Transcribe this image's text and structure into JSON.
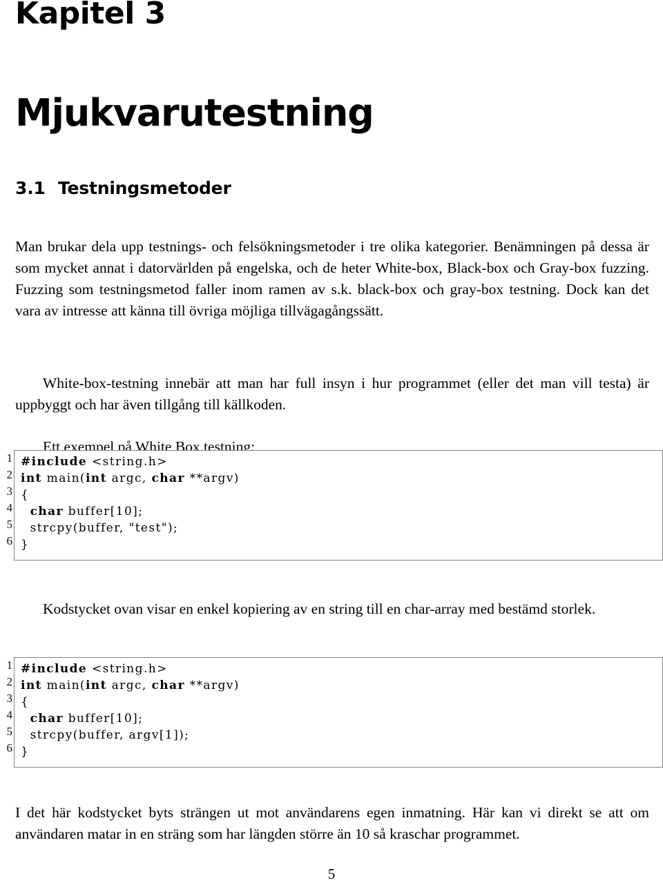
{
  "document": {
    "chapter_label": "Kapitel 3",
    "chapter_title": "Mjukvarutestning",
    "page_number": "5"
  },
  "section": {
    "number": "3.1",
    "title": "Testningsmetoder"
  },
  "paragraphs": {
    "p1": "Man brukar dela upp testnings- och felsökningsmetoder i tre olika kategorier. Benämningen på dessa är som mycket annat i datorvärlden på engelska, och de heter White-box, Black-box och Gray-box fuzzing. Fuzzing som testningsmetod faller inom ramen av s.k. black-box och gray-box testning. Dock kan det vara av intresse att känna till övriga möjliga tillvägagångssätt.",
    "p2": "White-box-testning innebär att man har full insyn i hur programmet (eller det man vill testa) är uppbyggt och har även tillgång till källkoden.",
    "p3": "Ett exempel på White Box testning:",
    "p4": "Kodstycket ovan visar en enkel kopiering av en string till en char-array med bestämd storlek.",
    "p5": "I det här kodstycket byts strängen ut mot användarens egen inmatning. Här kan vi direkt se att om användaren matar in en sträng som har längden större än 10 så kraschar programmet."
  },
  "listings": [
    {
      "id": "listing-1",
      "language": "c",
      "line_numbers": [
        "1",
        "2",
        "3",
        "4",
        "5",
        "6"
      ],
      "lines": [
        "#include <string.h>",
        "int main(int argc, char **argv)",
        "{",
        "   char buffer[10];",
        "   strcpy(buffer, \"test\");",
        "}"
      ],
      "lines_html": [
        "<b>#include</b> &lt;string.h&gt;",
        "<b>int</b> main(<b>int</b> argc, <b>char</b> **argv)",
        "{",
        "  <b>char</b> buffer[10];",
        "  strcpy(buffer, \"test\");",
        "}"
      ]
    },
    {
      "id": "listing-2",
      "language": "c",
      "line_numbers": [
        "1",
        "2",
        "3",
        "4",
        "5",
        "6"
      ],
      "lines": [
        "#include <string.h>",
        "int main(int argc, char **argv)",
        "{",
        "   char buffer[10];",
        "   strcpy(buffer, argv[1]);",
        "}"
      ],
      "lines_html": [
        "<b>#include</b> &lt;string.h&gt;",
        "<b>int</b> main(<b>int</b> argc, <b>char</b> **argv)",
        "{",
        "  <b>char</b> buffer[10];",
        "  strcpy(buffer, argv[1]);",
        "}"
      ]
    }
  ],
  "colors": {
    "text": "#000000",
    "page_background": "#ffffff",
    "listing_border": "#808080"
  }
}
